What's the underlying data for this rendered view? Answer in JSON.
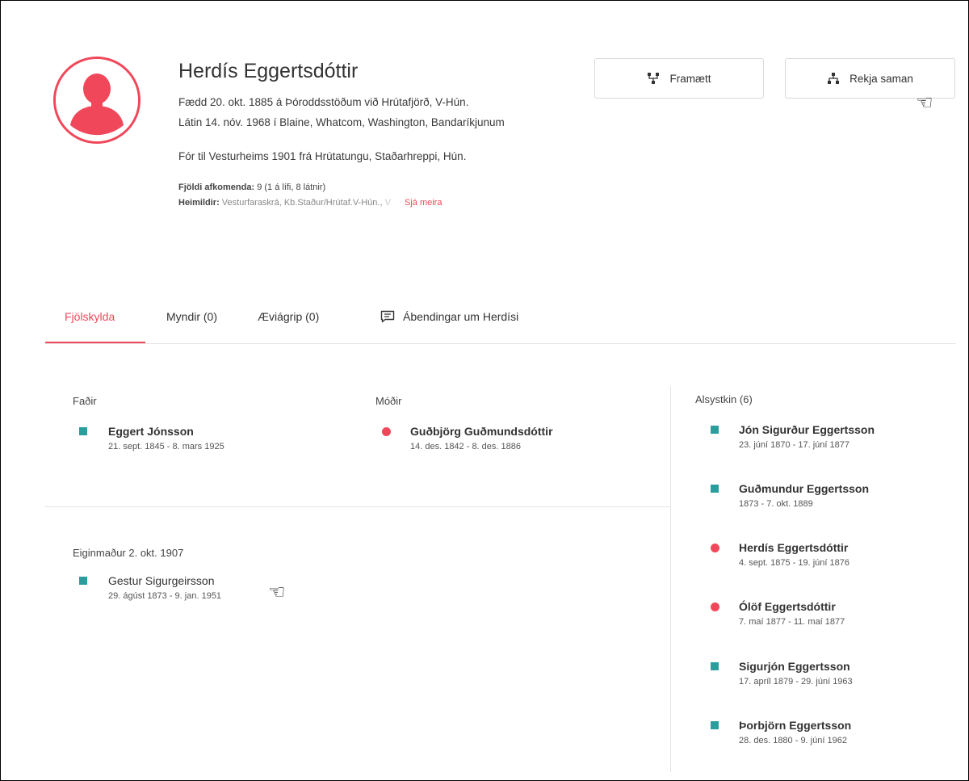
{
  "profile": {
    "name": "Herdís Eggertsdóttir",
    "born": "Fædd 20. okt. 1885 á Þóroddsstöðum við Hrútafjörð, V-Hún.",
    "died": "Látin 14. nóv. 1968 í Blaine, Whatcom, Washington, Bandaríkjunum",
    "emigration": "Fór til Vesturheims 1901 frá Hrútatungu, Staðarhreppi, Hún.",
    "descendants_label": "Fjöldi afkomenda:",
    "descendants_value": "9 (1 á lífi, 8 látnir)",
    "sources_label": "Heimildir:",
    "sources_value": "Vesturfaraskrá, Kb.Staður/Hrútaf.V-Hún.,",
    "sources_fade": " V",
    "see_more": "Sjá meira",
    "avatar_icon": "person-icon"
  },
  "actions": {
    "forn_label": "Framætt",
    "forn_icon": "ancestry-tree-icon",
    "rekja_label": "Rekja saman",
    "rekja_icon": "relationship-tree-icon"
  },
  "tabs": [
    {
      "label": "Fjölskylda",
      "active": true
    },
    {
      "label": "Myndir (0)",
      "active": false
    },
    {
      "label": "Æviágrip (0)",
      "active": false
    },
    {
      "label": "Ábendingar um Herdísi",
      "active": false,
      "icon": "comment-icon"
    }
  ],
  "family": {
    "father": {
      "label": "Faðir",
      "name": "Eggert Jónsson",
      "dates": "21. sept. 1845 - 8. mars 1925",
      "gender": "male"
    },
    "mother": {
      "label": "Móðir",
      "name": "Guðbjörg Guðmundsdóttir",
      "dates": "14. des. 1842 - 8. des. 1886",
      "gender": "female"
    },
    "spouse": {
      "label": "Eiginmaður 2. okt. 1907",
      "name": "Gestur Sigurgeirsson",
      "dates": "29. ágúst 1873 - 9. jan. 1951",
      "gender": "male"
    }
  },
  "siblings": {
    "label": "Alsystkin (6)",
    "items": [
      {
        "name": "Jón Sigurður Eggertsson",
        "dates": "23. júní 1870 - 17. júní 1877",
        "gender": "male"
      },
      {
        "name": "Guðmundur Eggertsson",
        "dates": "1873 - 7. okt. 1889",
        "gender": "male"
      },
      {
        "name": "Herdís Eggertsdóttir",
        "dates": "4. sept. 1875 - 19. júní 1876",
        "gender": "female"
      },
      {
        "name": "Ólöf Eggertsdóttir",
        "dates": "7. maí 1877 - 11. maí 1877",
        "gender": "female"
      },
      {
        "name": "Sigurjón Eggertsson",
        "dates": "17. apríl 1879 - 29. júní 1963",
        "gender": "male"
      },
      {
        "name": "Þorbjörn Eggertsson",
        "dates": "28. des. 1880 - 9. júní 1962",
        "gender": "male"
      }
    ]
  },
  "colors": {
    "accent": "#f0485a",
    "male": "#2a9d9d",
    "female": "#f0485a"
  },
  "cursor_icon": "pointing-hand-cursor-icon"
}
